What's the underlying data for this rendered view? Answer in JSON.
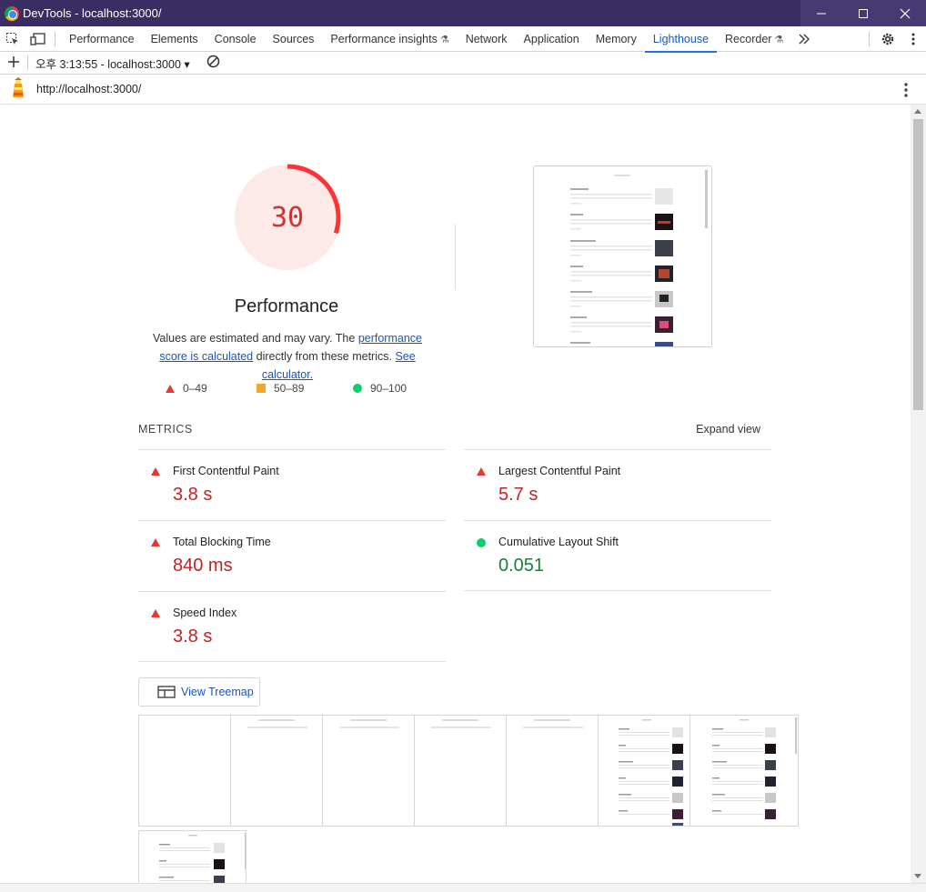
{
  "window": {
    "title": "DevTools - localhost:3000/"
  },
  "tabs": [
    {
      "label": "Performance"
    },
    {
      "label": "Elements"
    },
    {
      "label": "Console"
    },
    {
      "label": "Sources"
    },
    {
      "label": "Performance insights"
    },
    {
      "label": "Network"
    },
    {
      "label": "Application"
    },
    {
      "label": "Memory"
    },
    {
      "label": "Lighthouse"
    },
    {
      "label": "Recorder"
    }
  ],
  "toolbar": {
    "report_select": "오후 3:13:55 - localhost:3000"
  },
  "url": "http://localhost:3000/",
  "gauge": {
    "score": "30",
    "score_value": 30,
    "label": "Performance",
    "desc_prefix": "Values are estimated and may vary. The ",
    "desc_link1": "performance score is calculated",
    "desc_mid": " directly from these metrics. ",
    "desc_link2": "See calculator."
  },
  "legend": {
    "fail": "0–49",
    "average": "50–89",
    "pass": "90–100"
  },
  "metrics": {
    "title": "METRICS",
    "expand": "Expand view",
    "fcp": {
      "name": "First Contentful Paint",
      "value": "3.8 s"
    },
    "lcp": {
      "name": "Largest Contentful Paint",
      "value": "5.7 s"
    },
    "tbt": {
      "name": "Total Blocking Time",
      "value": "840 ms"
    },
    "cls": {
      "name": "Cumulative Layout Shift",
      "value": "0.051"
    },
    "si": {
      "name": "Speed Index",
      "value": "3.8 s"
    }
  },
  "treemap": {
    "label": "View Treemap"
  },
  "colors": {
    "fail": "#e53935",
    "average": "#f4a62a",
    "pass": "#0cce6b",
    "accent": "#1a73e8",
    "titlebar": "#3a2d63"
  }
}
